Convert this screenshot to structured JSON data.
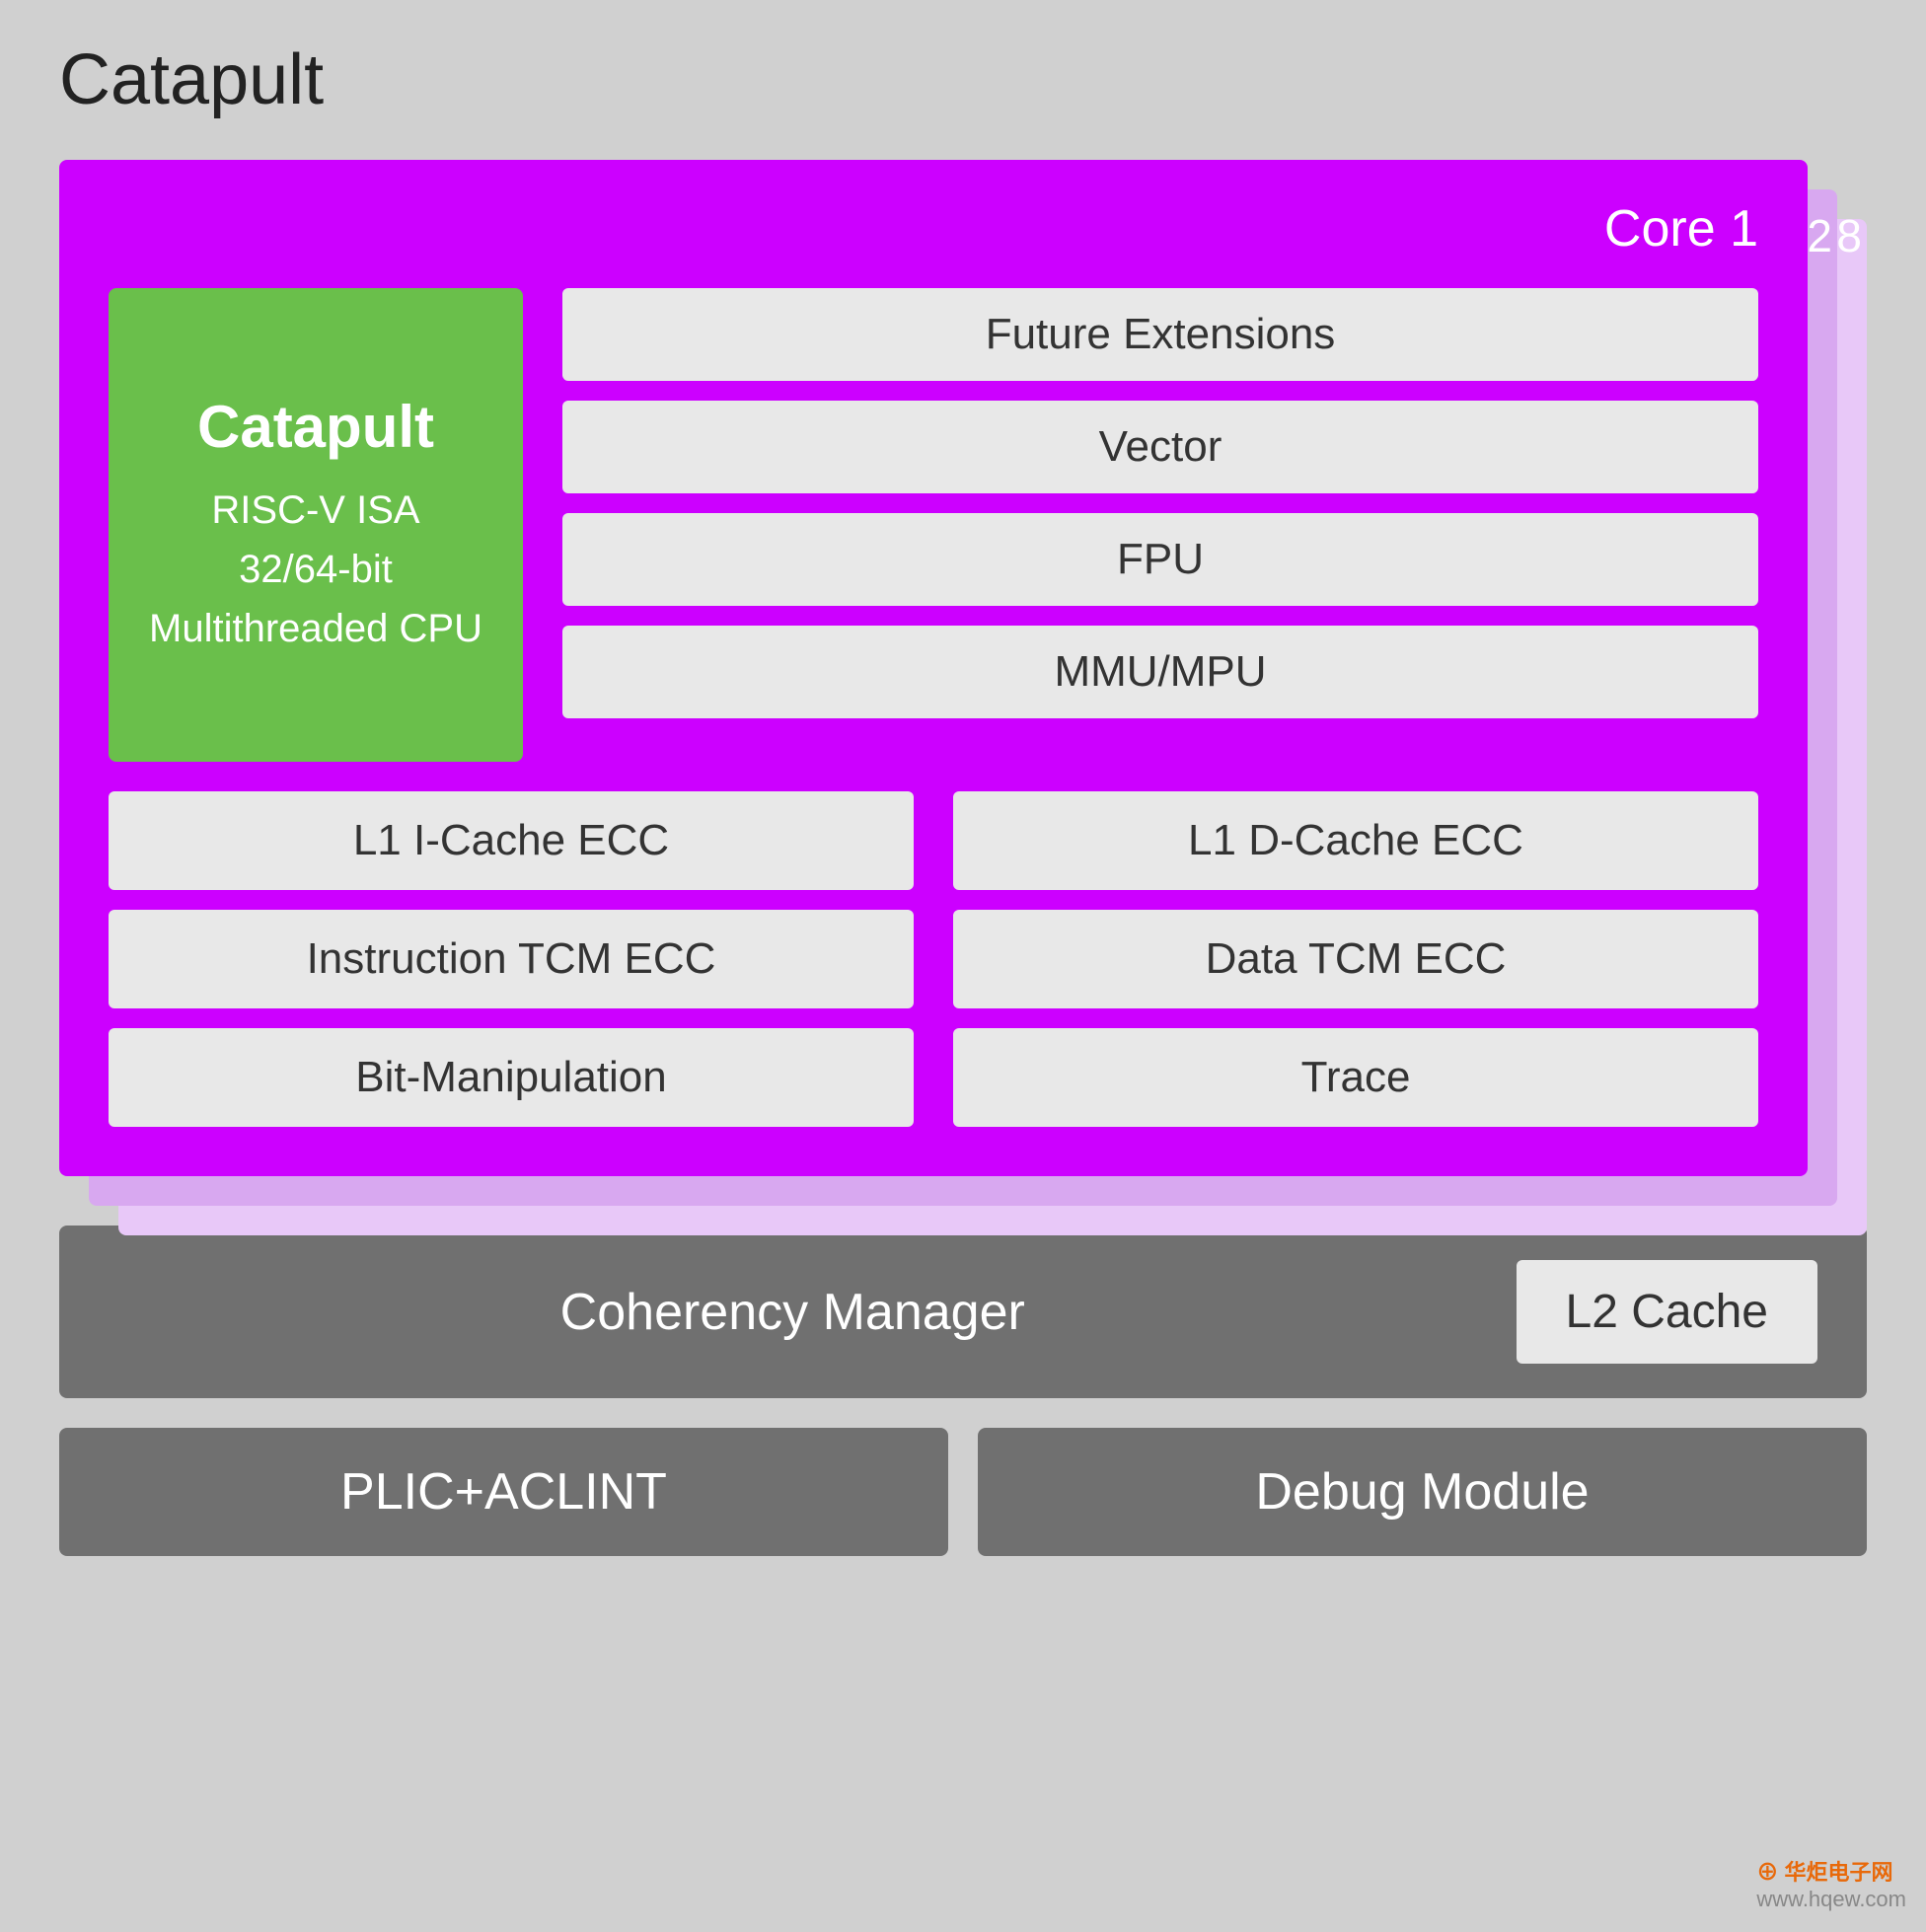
{
  "title": "Catapult",
  "core_stack": {
    "core1_label": "Core 1",
    "core2_label": "2",
    "core8_label": "8",
    "catapult": {
      "brand": "Catapult",
      "line1": "RISC-V ISA",
      "line2": "32/64-bit",
      "line3": "Multithreaded CPU"
    },
    "extensions": [
      "Future Extensions",
      "Vector",
      "FPU",
      "MMU/MPU"
    ],
    "bottom_rows": [
      {
        "left": "L1 I-Cache ECC",
        "right": "L1 D-Cache ECC"
      },
      {
        "left": "Instruction TCM ECC",
        "right": "Data TCM ECC"
      },
      {
        "left": "Bit-Manipulation",
        "right": "Trace"
      }
    ]
  },
  "lower": {
    "coherency_label": "Coherency Manager",
    "l2_label": "L2 Cache",
    "plic_label": "PLIC+ACLINT",
    "debug_label": "Debug Module"
  },
  "watermark": {
    "text": "华炬电子网",
    "url": "www.hqew.com"
  }
}
